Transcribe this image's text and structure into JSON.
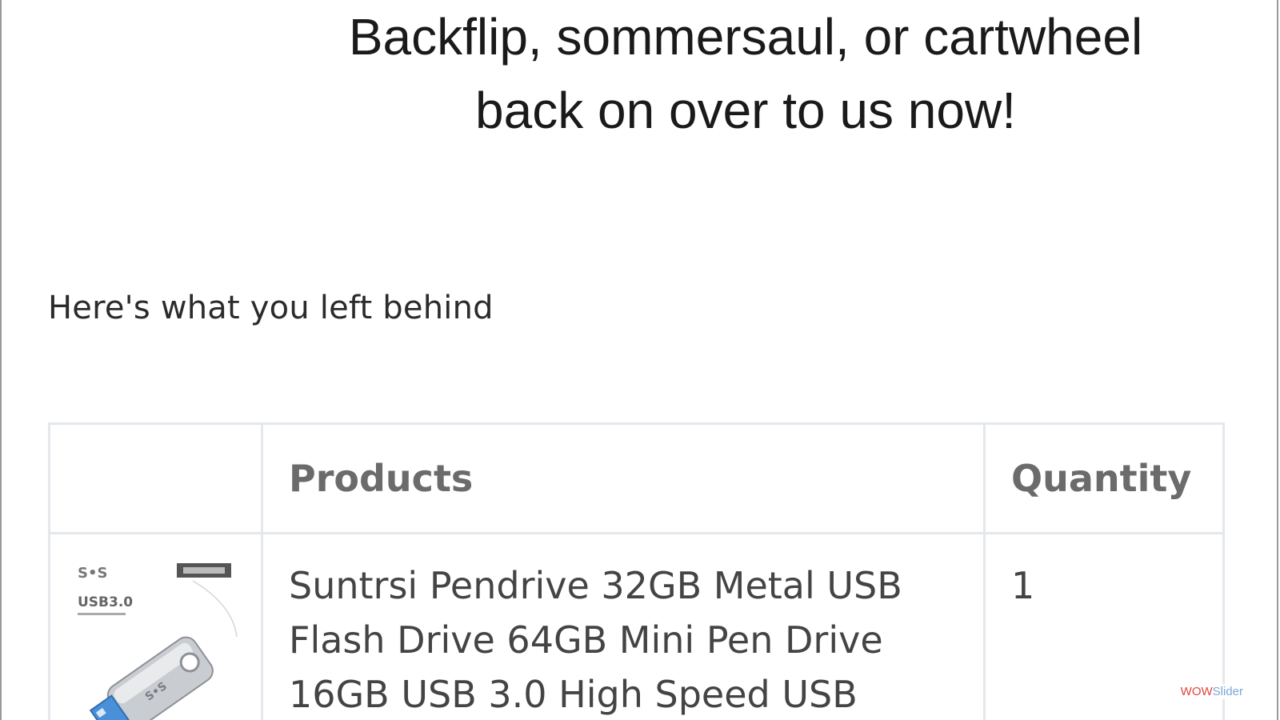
{
  "headline": {
    "line1": "Backflip, sommersaul, or cartwheel",
    "line2": "back on over to us now!"
  },
  "subtitle": "Here's what you left behind",
  "cart_table": {
    "headers": [
      "",
      "Products",
      "Quantity"
    ],
    "rows": [
      {
        "image": "usb-flash-drive-image",
        "product": "Suntrsi Pendrive 32GB Metal USB Flash Drive 64GB Mini Pen Drive 16GB USB 3.0 High Speed USB",
        "quantity": "1"
      }
    ]
  },
  "product_image_text": {
    "brand_mark": "S•S",
    "badge": "USB3.0"
  },
  "watermark": {
    "part1": "WOW",
    "part2": "Slider"
  }
}
